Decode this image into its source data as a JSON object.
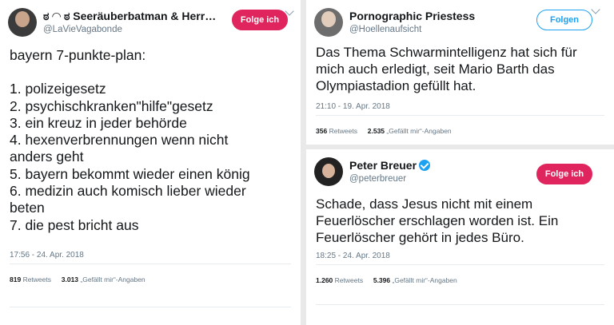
{
  "colors": {
    "follow_red": "#e0245e",
    "follow_blue": "#1da1f2",
    "muted_text": "#657786",
    "background": "#e9e9e9"
  },
  "tweets": [
    {
      "display_name": "ಠ ◠ ಠ Seeräuberbatman & Herrs...",
      "handle": "@LaVieVagabonde",
      "follow_label": "Folge ich",
      "verified": false,
      "text_lines": [
        "bayern 7-punkte-plan:",
        "",
        "1. polizeigesetz",
        "2. psychischkranken\"hilfe\"gesetz",
        "3. ein kreuz in jeder behörde",
        "4. hexenverbrennungen wenn nicht",
        "anders geht",
        "5. bayern bekommt wieder einen könig",
        "6. medizin auch komisch lieber wieder",
        "beten",
        "7. die pest bricht aus"
      ],
      "timestamp": "17:56 - 24. Apr. 2018",
      "retweets_count": "819",
      "retweets_label": "Retweets",
      "likes_count": "3.013",
      "likes_label": "„Gefällt mir“-Angaben"
    },
    {
      "display_name": "Pornographic Priestess",
      "handle": "@Hoellenaufsicht",
      "follow_label": "Folgen",
      "verified": false,
      "text_lines": [
        "Das Thema Schwarmintelligenz hat sich für",
        "mich auch erledigt, seit Mario Barth das",
        "Olympiastadion gefüllt hat."
      ],
      "timestamp": "21:10 - 19. Apr. 2018",
      "retweets_count": "356",
      "retweets_label": "Retweets",
      "likes_count": "2.535",
      "likes_label": "„Gefällt mir“-Angaben"
    },
    {
      "display_name": "Peter Breuer",
      "handle": "@peterbreuer",
      "follow_label": "Folge ich",
      "verified": true,
      "text_lines": [
        "Schade, dass Jesus nicht mit einem",
        "Feuerlöscher erschlagen worden ist. Ein",
        "Feuerlöscher gehört in jedes Büro."
      ],
      "timestamp": "18:25 - 24. Apr. 2018",
      "retweets_count": "1.260",
      "retweets_label": "Retweets",
      "likes_count": "5.396",
      "likes_label": "„Gefällt mir“-Angaben"
    }
  ]
}
